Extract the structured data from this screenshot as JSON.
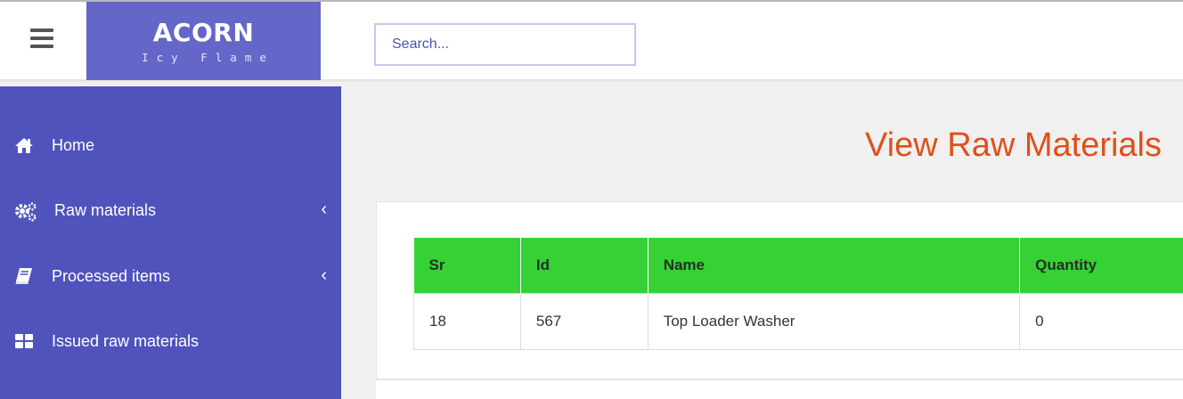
{
  "brand": {
    "title": "ACORN",
    "subtitle": "Icy Flame"
  },
  "header": {
    "search_placeholder": "Search..."
  },
  "sidebar": {
    "items": [
      {
        "label": "Home",
        "icon": "home-icon",
        "has_caret": false
      },
      {
        "label": "Raw materials",
        "icon": "gears-icon",
        "has_caret": true
      },
      {
        "label": "Processed items",
        "icon": "book-icon",
        "has_caret": true
      },
      {
        "label": "Issued raw materials",
        "icon": "grid-icon",
        "has_caret": false
      }
    ],
    "caret": "‹"
  },
  "main": {
    "title": "View Raw Materials",
    "table": {
      "headers": [
        "Sr",
        "Id",
        "Name",
        "Quantity"
      ],
      "rows": [
        [
          "18",
          "567",
          "Top Loader Washer",
          "0"
        ]
      ]
    }
  },
  "colors": {
    "sidebar": "#4f53bb",
    "brand": "#6466c8",
    "title": "#e0501a",
    "table_header": "#36d135"
  }
}
